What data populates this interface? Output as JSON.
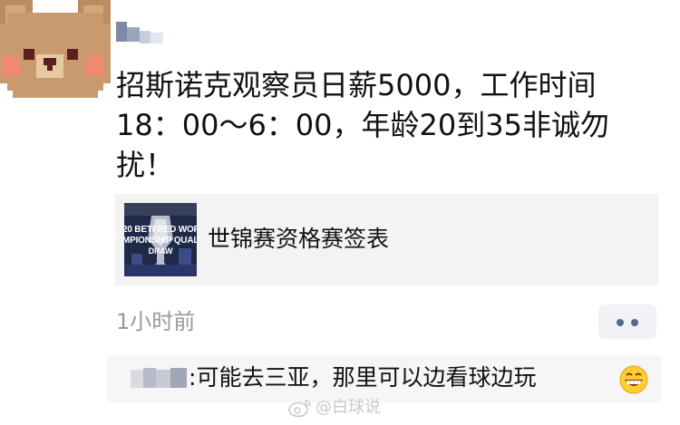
{
  "post": {
    "author_avatar_icon": "pixel-bear-avatar",
    "text": "招斯诺克观察员日薪5000，工作时间\n18：00～6：00，年龄20到35非诚勿\n扰！",
    "link_card": {
      "thumb_lines": [
        "20 BETFRED WOR",
        "MPIONSHIP QUAL",
        "DRAW"
      ],
      "title": "世锦赛资格赛签表"
    },
    "time": "1小时前",
    "more_icon": "more-dots-icon"
  },
  "comment": {
    "separator": ":",
    "text": "可能去三亚，那里可以边看球边玩",
    "emoji": "grinning-face-icon"
  },
  "watermark": {
    "text": "@白球说",
    "logo": "weibo-logo-icon"
  },
  "colors": {
    "card_bg": "#f3f3f3",
    "comment_bg": "#f6f6f6",
    "more_dots": "#54678c",
    "time_text": "#9a9a9a"
  }
}
